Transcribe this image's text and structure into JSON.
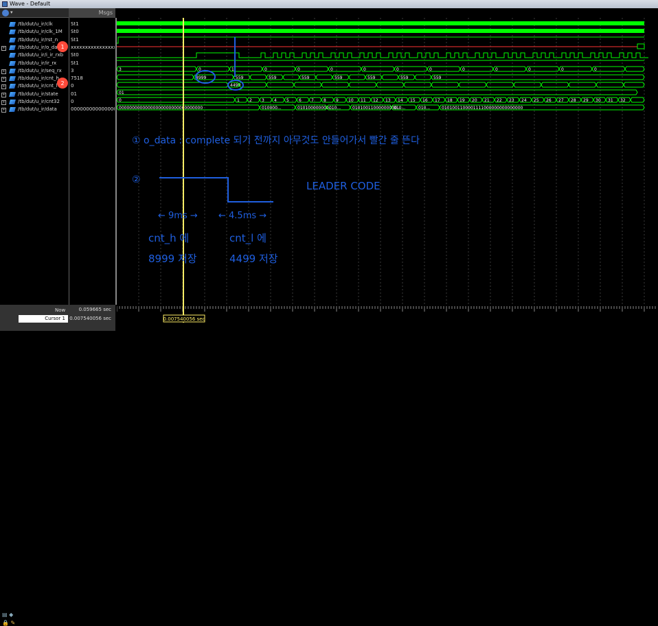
{
  "window": {
    "title": "Wave - Default"
  },
  "values_header": "Msgs",
  "signals": [
    {
      "expand": "",
      "name": "/tb/dut/u_ir/clk",
      "value": "St1"
    },
    {
      "expand": "",
      "name": "/tb/dut/u_ir/clk_1M",
      "value": "St0"
    },
    {
      "expand": "",
      "name": "/tb/dut/u_ir/rst_n",
      "value": "St1"
    },
    {
      "expand": "+",
      "name": "/tb/dut/u_ir/o_da",
      "value": "xxxxxxxxxxxxxxxx..."
    },
    {
      "expand": "",
      "name": "/tb/dut/u_ir/i_ir_rxb",
      "value": "St0"
    },
    {
      "expand": "",
      "name": "/tb/dut/u_ir/ir_rx",
      "value": "St1"
    },
    {
      "expand": "+",
      "name": "/tb/dut/u_ir/seq_rx",
      "value": "3"
    },
    {
      "expand": "+",
      "name": "/tb/dut/u_ir/cnt_h",
      "value": "7518"
    },
    {
      "expand": "+",
      "name": "/tb/dut/u_ir/cnt_l",
      "value": "0"
    },
    {
      "expand": "+",
      "name": "/tb/dut/u_ir/state",
      "value": "01"
    },
    {
      "expand": "+",
      "name": "/tb/dut/u_ir/cnt32",
      "value": "0"
    },
    {
      "expand": "+",
      "name": "/tb/dut/u_ir/data",
      "value": "0000000000000000..."
    }
  ],
  "wave_labels": {
    "seq_rx": [
      "3",
      "0",
      "1",
      "0",
      "0",
      "0",
      "0",
      "0",
      "0",
      "0",
      "0",
      "0",
      "0",
      "0"
    ],
    "cnt_h_first": "8999",
    "cnt_h_repeat": "559",
    "cnt_l_first": "4499",
    "state": "01",
    "cnt32": [
      "0",
      "1",
      "2",
      "3",
      "4",
      "5",
      "6",
      "7",
      "8",
      "9",
      "10",
      "11",
      "12",
      "13",
      "14",
      "15",
      "16",
      "17",
      "18",
      "19",
      "20",
      "21",
      "22",
      "23",
      "24",
      "25",
      "26",
      "27",
      "28",
      "29",
      "30",
      "31",
      "32"
    ],
    "data": [
      "00000000000000000000000000000000",
      "010000...",
      "010100000000...",
      "010...",
      "01010011000000000...",
      "010...",
      "010...",
      "0101001100001111000000000000000"
    ]
  },
  "annotations": {
    "note1": "① o_data : complete 되기 전까지 아무것도 안들어가서 빨간 줄 뜬다",
    "note2_marker": "②",
    "leader": "LEADER CODE",
    "dur_h": "← 9ms →",
    "dur_l": "← 4.5ms →",
    "cnt_h_label": "cnt_h 에",
    "cnt_h_store": "8999 저장",
    "cnt_l_label": "cnt_l 에",
    "cnt_l_store": "4499 저장",
    "badge1": "1",
    "badge2": "2"
  },
  "status": {
    "now_label": "Now",
    "now_value": "0.059665 sec",
    "cursor_label": "Cursor 1",
    "cursor_value": "0.007540056 sec",
    "cursor_tag": "0.007540056 sec"
  },
  "colors": {
    "wave": "#00ff00",
    "cursor": "#ffee66",
    "ink": "#1f5fe0",
    "error": "#ff3333"
  }
}
